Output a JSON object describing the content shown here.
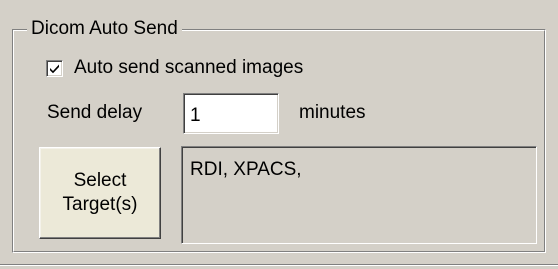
{
  "group": {
    "title": "Dicom Auto Send"
  },
  "auto_send": {
    "label": "Auto send scanned images",
    "checked": true,
    "icon": "checkmark-icon"
  },
  "send_delay": {
    "label": "Send delay",
    "value": "1",
    "unit_label": "minutes"
  },
  "select_button": {
    "line1": "Select",
    "line2": "Target(s)"
  },
  "targets": {
    "text": "RDI, XPACS,"
  },
  "colors": {
    "face": "#d4d0c8",
    "button_face": "#ece9d8",
    "field": "#ffffff",
    "shadow": "#808080",
    "dark_shadow": "#404040",
    "highlight": "#ffffff"
  }
}
